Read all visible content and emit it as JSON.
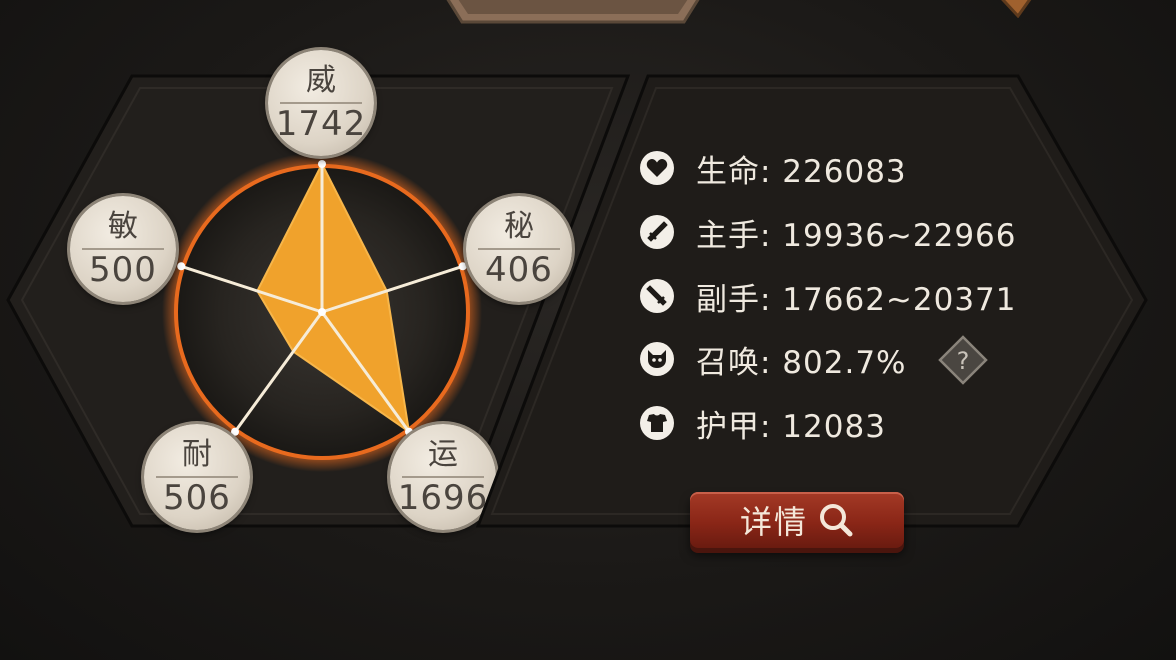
{
  "stats": {
    "wei": {
      "name": "威",
      "value": "1742"
    },
    "mi": {
      "name": "秘",
      "value": "406"
    },
    "yun": {
      "name": "运",
      "value": "1696"
    },
    "nai": {
      "name": "耐",
      "value": "506"
    },
    "min": {
      "name": "敏",
      "value": "500"
    }
  },
  "radar_levels": {
    "wei": 1.0,
    "mi": 0.46,
    "yun": 1.0,
    "nai": 0.33,
    "min": 0.46
  },
  "attributes": [
    {
      "icon": "heart-icon",
      "label": "生命: 226083"
    },
    {
      "icon": "sword-icon",
      "label": "主手: 19936~22966"
    },
    {
      "icon": "sword-offhand-icon",
      "label": "副手: 17662~20371"
    },
    {
      "icon": "summon-beast-icon",
      "label": "召唤: 802.7%"
    },
    {
      "icon": "armor-icon",
      "label": "护甲: 12083"
    }
  ],
  "detail_button": {
    "label": "详情",
    "icon": "search-icon"
  },
  "help": {
    "symbol": "?"
  },
  "colors": {
    "radar_fill": "#f0a22c",
    "ring": "#e86a1e",
    "button": "#8a2617"
  }
}
